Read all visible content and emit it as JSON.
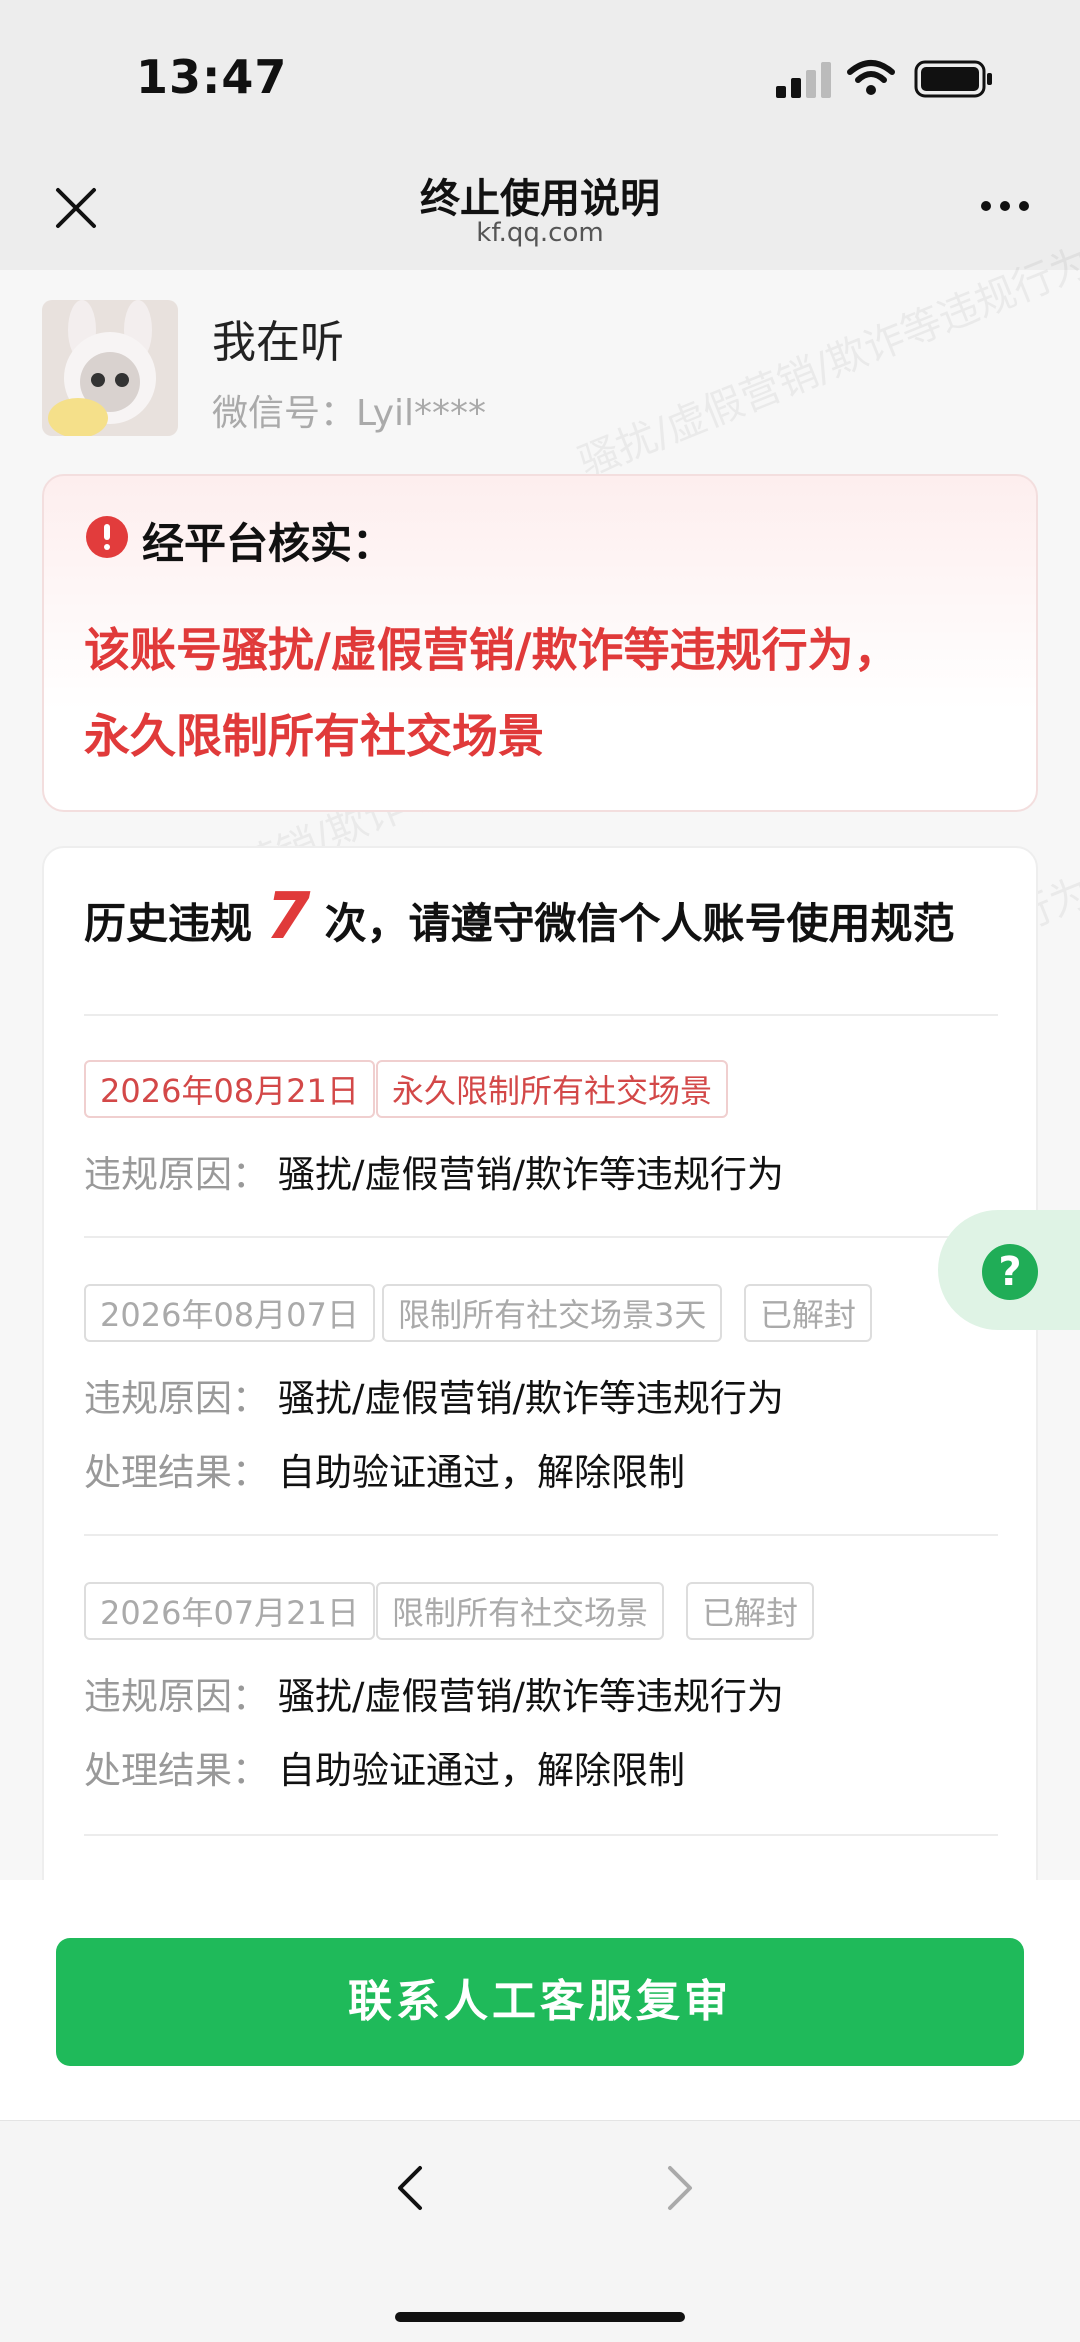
{
  "status_bar": {
    "time": "13:47"
  },
  "nav": {
    "title": "终止使用说明",
    "domain": "kf.qq.com"
  },
  "profile": {
    "nickname": "我在听",
    "wechat_id": "微信号：Lyil****"
  },
  "notice": {
    "title": "经平台核实：",
    "line1": "该账号骚扰/虚假营销/欺诈等违规行为，",
    "line2": "永久限制所有社交场景"
  },
  "history": {
    "prefix": "历史违规",
    "count": "7",
    "suffix": "次，请遵守微信个人账号使用规范",
    "records": [
      {
        "date": "2026年08月21日",
        "measure": "永久限制所有社交场景",
        "reason_label": "违规原因：",
        "reason": "骚扰/虚假营销/欺诈等违规行为"
      },
      {
        "date": "2026年08月07日",
        "measure": "限制所有社交场景3天",
        "status": "已解封",
        "reason_label": "违规原因：",
        "reason": "骚扰/虚假营销/欺诈等违规行为",
        "result_label": "处理结果：",
        "result": "自助验证通过，解除限制"
      },
      {
        "date": "2026年07月21日",
        "measure": "限制所有社交场景",
        "status": "已解封",
        "reason_label": "违规原因：",
        "reason": "骚扰/虚假营销/欺诈等违规行为",
        "result_label": "处理结果：",
        "result": "自助验证通过，解除限制"
      }
    ]
  },
  "help": {
    "icon": "question-icon",
    "glyph": "?"
  },
  "cta": {
    "label": "联系人工客服复审"
  },
  "watermark": {
    "text": "骚扰/虚假营销/欺诈等违规行为"
  },
  "colors": {
    "accent_green": "#1fba5a",
    "alert_red": "#e03a3a"
  }
}
